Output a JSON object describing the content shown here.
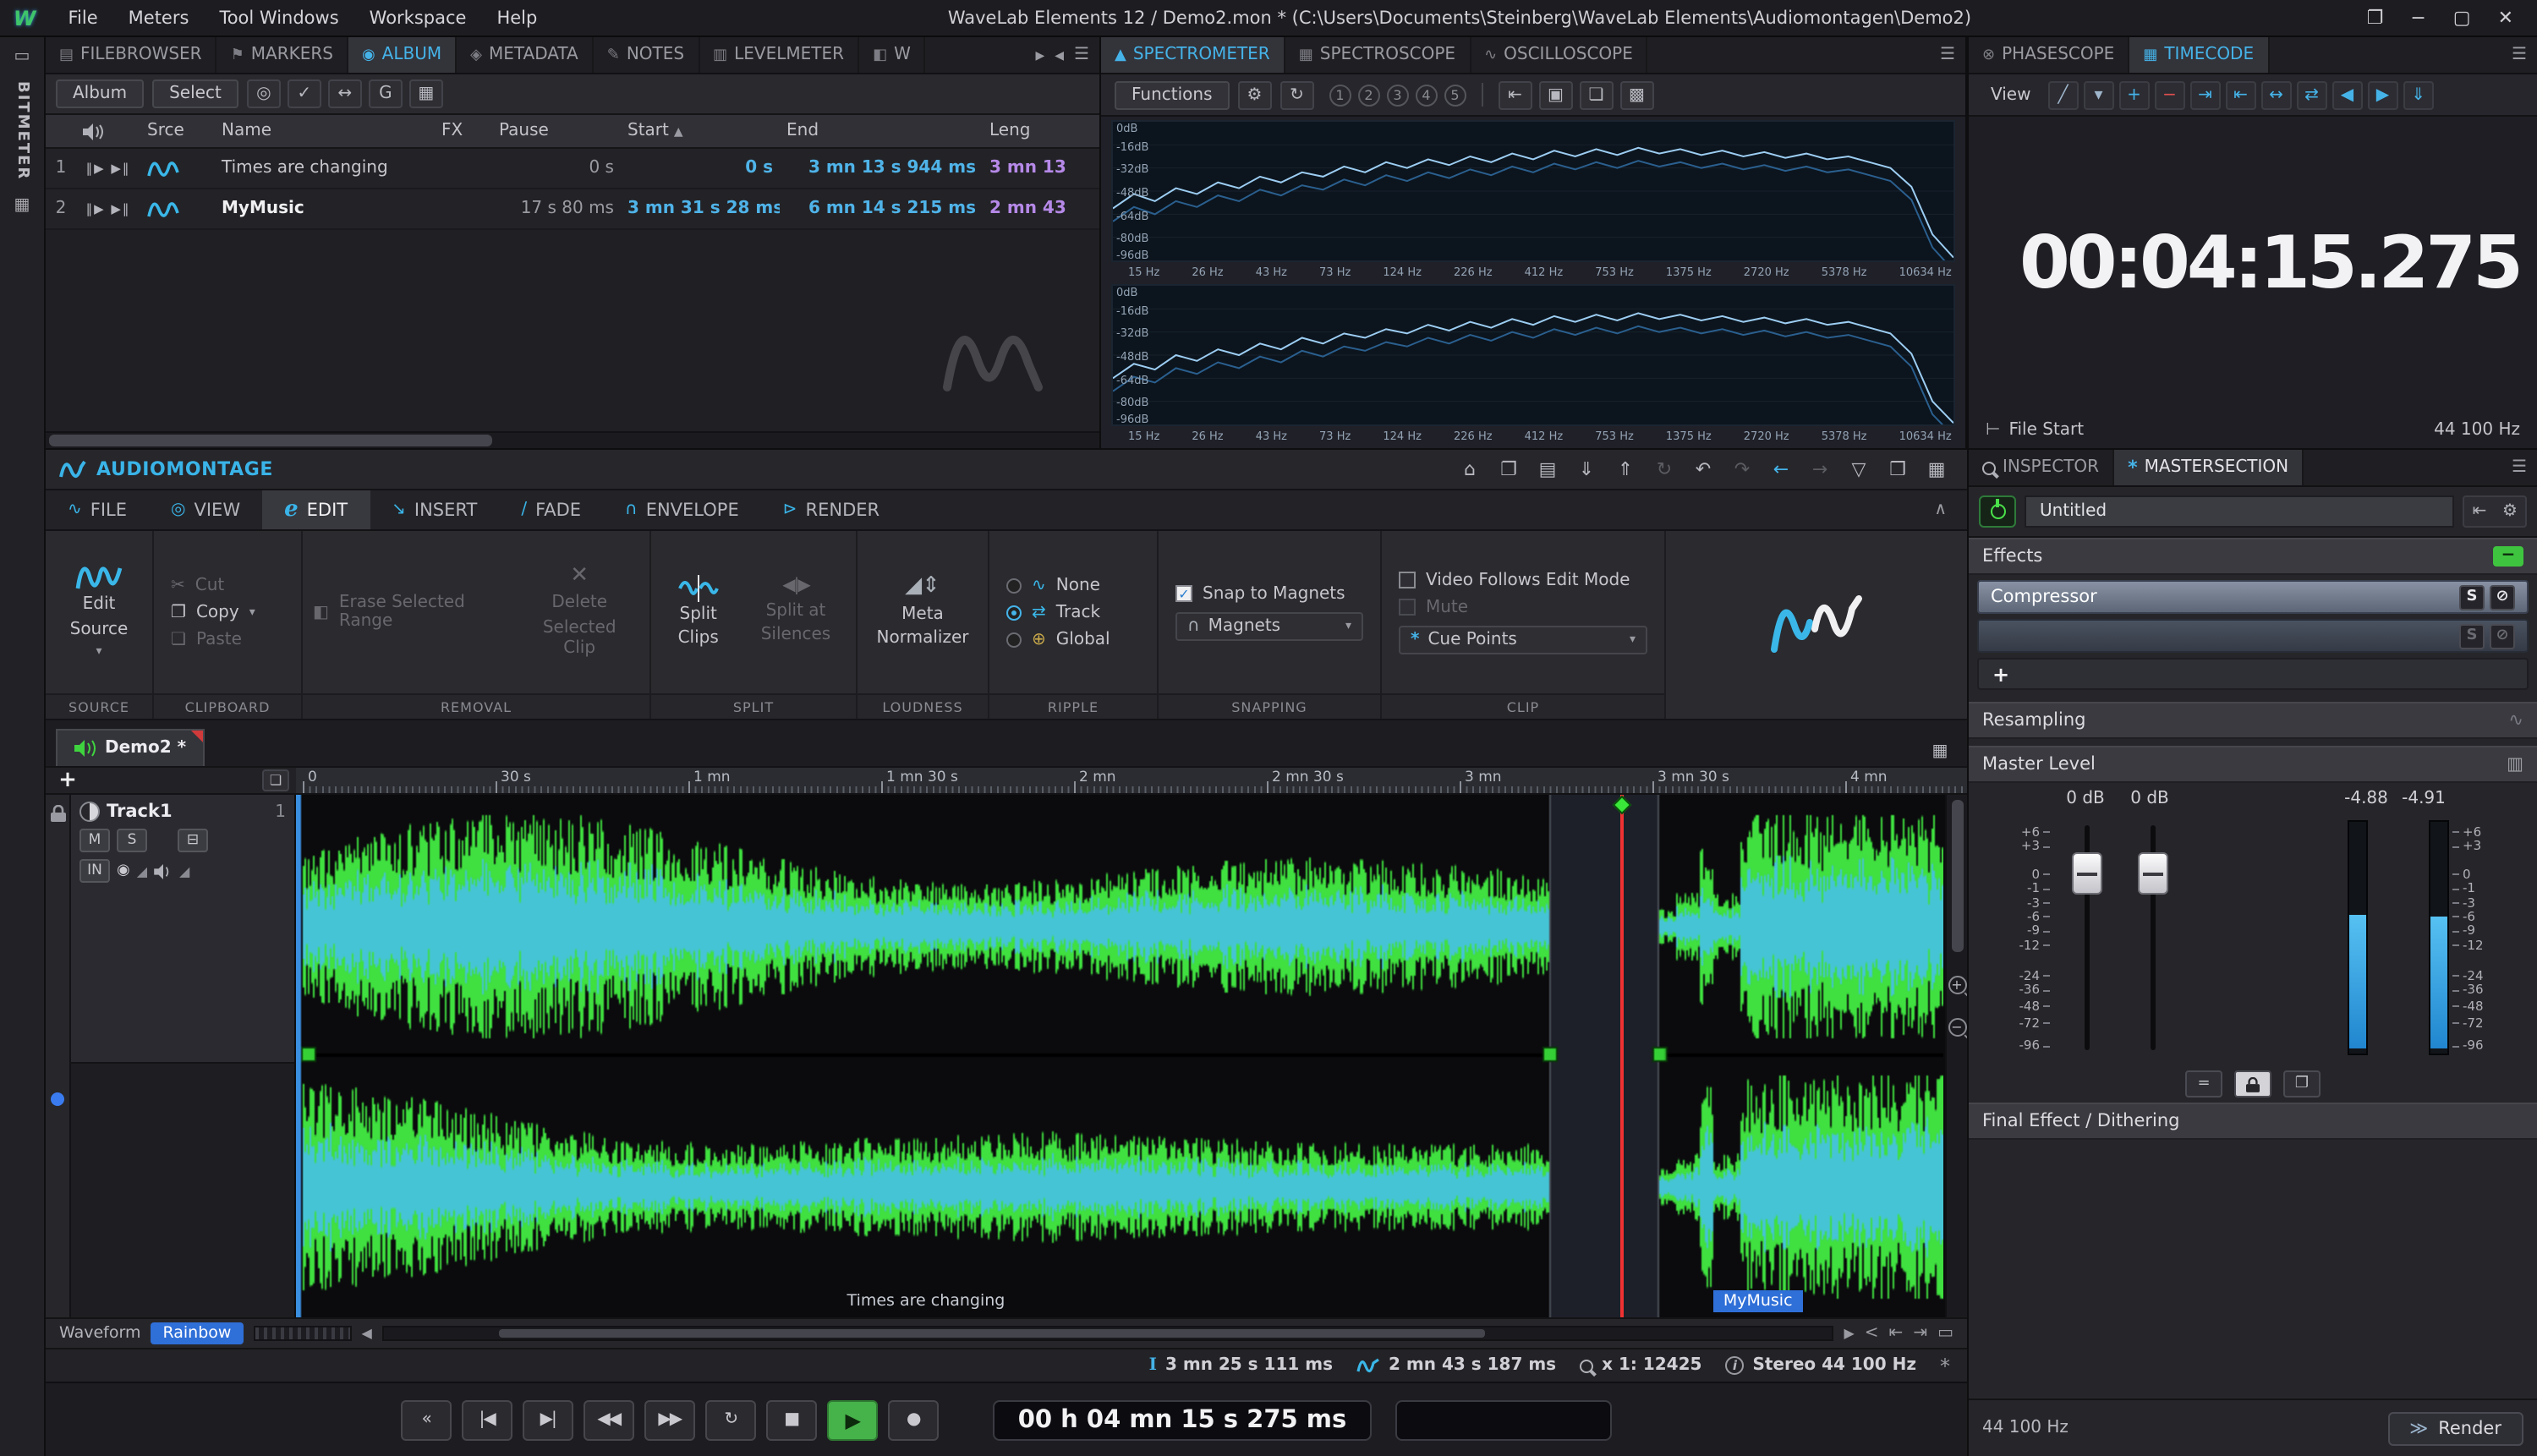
{
  "window": {
    "menu_items": [
      "File",
      "Meters",
      "Tool Windows",
      "Workspace",
      "Help"
    ],
    "title": "WaveLab Elements 12 / Demo2.mon * (C:\\Users\\Documents\\Steinberg\\WaveLab Elements\\Audiomontagen\\Demo2)",
    "logo": "W",
    "controls": [
      {
        "g": "❐",
        "n": "fullscreen-button"
      },
      {
        "g": "−",
        "n": "minimize-button"
      },
      {
        "g": "▢",
        "n": "maximize-button"
      },
      {
        "g": "✕",
        "n": "close-button"
      }
    ]
  },
  "bitmeter": {
    "label": "BITMETER"
  },
  "album": {
    "tabs": [
      {
        "icon": "▤",
        "label": "FILEBROWSER"
      },
      {
        "icon": "⚑",
        "label": "MARKERS"
      },
      {
        "icon": "◉",
        "label": "ALBUM"
      },
      {
        "icon": "◈",
        "label": "METADATA"
      },
      {
        "icon": "✎",
        "label": "NOTES"
      },
      {
        "icon": "▥",
        "label": "LEVELMETER"
      },
      {
        "icon": "◧",
        "label": "W"
      }
    ],
    "active_tab": 2,
    "buttons": [
      "Album",
      "Select"
    ],
    "tool_icons": [
      {
        "g": "◎",
        "n": "autoplay-mode-button"
      },
      {
        "g": "✓",
        "n": "apply-button"
      },
      {
        "g": "↔",
        "n": "pregap-button"
      },
      {
        "g": "G",
        "n": "regenerate-button"
      },
      {
        "g": "▦",
        "n": "grid-button"
      }
    ],
    "columns": [
      "Srce",
      "Name",
      "FX",
      "Pause",
      "Start",
      "End",
      "Leng"
    ],
    "rows": [
      {
        "num": "1",
        "name": "Times are changing",
        "pause": "0 s",
        "start": "0 s",
        "end": "3 mn 13 s 944 ms",
        "leng": "3 mn 13"
      },
      {
        "num": "2",
        "name": "MyMusic",
        "pause": "17 s 80 ms",
        "start": "3 mn 31 s 28 ms",
        "end": "6 mn 14 s 215 ms",
        "leng": "2 mn 43"
      }
    ]
  },
  "spectro": {
    "tabs": [
      {
        "icon": "▲",
        "label": "SPECTROMETER"
      },
      {
        "icon": "▦",
        "label": "SPECTROSCOPE"
      },
      {
        "icon": "∿",
        "label": "OSCILLOSCOPE"
      }
    ],
    "active_tab": 0,
    "functions": "Functions",
    "gear": "⚙",
    "refresh": "↻",
    "presets": [
      "1",
      "2",
      "3",
      "4",
      "5"
    ],
    "right_icons": [
      {
        "g": "⇤",
        "n": "export-spectrum-button"
      },
      {
        "g": "▣",
        "n": "snapshot-button"
      },
      {
        "g": "❏",
        "n": "copy-spectrum-button"
      },
      {
        "g": "▩",
        "n": "save-image-button"
      }
    ],
    "db": [
      "0dB",
      "-16dB",
      "-32dB",
      "-48dB",
      "-64dB",
      "-80dB",
      "-96dB"
    ],
    "freq": [
      "15 Hz",
      "26 Hz",
      "43 Hz",
      "73 Hz",
      "124 Hz",
      "226 Hz",
      "412 Hz",
      "753 Hz",
      "1375 Hz",
      "2720 Hz",
      "5378 Hz",
      "10634 Hz"
    ],
    "top": [
      -60,
      -50,
      -55,
      -46,
      -50,
      -42,
      -46,
      -38,
      -42,
      -35,
      -38,
      -31,
      -35,
      -28,
      -32,
      -26,
      -30,
      -24,
      -28,
      -22,
      -26,
      -20,
      -24,
      -19,
      -23,
      -18,
      -22,
      -19,
      -23,
      -20,
      -24,
      -21,
      -25,
      -22,
      -26,
      -24,
      -28,
      -32,
      -45,
      -78,
      -94
    ],
    "bottom": [
      -64,
      -54,
      -58,
      -48,
      -52,
      -44,
      -48,
      -40,
      -44,
      -36,
      -40,
      -33,
      -36,
      -30,
      -33,
      -27,
      -31,
      -25,
      -29,
      -23,
      -27,
      -21,
      -25,
      -20,
      -24,
      -19,
      -23,
      -20,
      -24,
      -21,
      -25,
      -22,
      -26,
      -23,
      -27,
      -25,
      -29,
      -33,
      -47,
      -80,
      -95
    ]
  },
  "timecode": {
    "tabs": [
      {
        "icon": "⊗",
        "label": "PHASESCOPE"
      },
      {
        "icon": "▦",
        "label": "TIMECODE"
      }
    ],
    "active_tab": 1,
    "view": "View",
    "tools": [
      {
        "g": "╱",
        "n": "line-tool-icon",
        "c": ""
      },
      {
        "g": "▾",
        "n": "drop-marker-icon",
        "c": ""
      },
      {
        "g": "+",
        "n": "add-marker-button",
        "c": "blue"
      },
      {
        "g": "−",
        "n": "delete-marker-button",
        "c": "red"
      },
      {
        "g": "⇥",
        "n": "snap-left-icon",
        "c": "blue"
      },
      {
        "g": "⇤",
        "n": "snap-right-icon",
        "c": "blue"
      },
      {
        "g": "↔",
        "n": "spread-markers-icon",
        "c": "blue"
      },
      {
        "g": "⇄",
        "n": "swap-markers-icon",
        "c": "blue"
      },
      {
        "g": "◀",
        "n": "prev-marker-icon",
        "c": "blue"
      },
      {
        "g": "▶",
        "n": "next-marker-icon",
        "c": "blue"
      },
      {
        "g": "⇓",
        "n": "import-markers-icon",
        "c": "blue"
      }
    ],
    "display": "00:04:15.275",
    "file_start": "File Start",
    "rate": "44 100 Hz"
  },
  "montage": {
    "title": "AUDIOMONTAGE",
    "header_icons": [
      {
        "g": "⌂",
        "n": "home-button",
        "c": ""
      },
      {
        "g": "❐",
        "n": "new-window-button",
        "c": ""
      },
      {
        "g": "▤",
        "n": "open-folder-button",
        "c": ""
      },
      {
        "g": "⇓",
        "n": "save-button",
        "c": ""
      },
      {
        "g": "⇑",
        "n": "export-button",
        "c": ""
      },
      {
        "g": "↻",
        "n": "sync-button",
        "c": "dim"
      },
      {
        "g": "↶",
        "n": "undo-button",
        "c": ""
      },
      {
        "g": "↷",
        "n": "redo-button",
        "c": "dim"
      },
      {
        "g": "←",
        "n": "nav-back-button",
        "c": "blue"
      },
      {
        "g": "→",
        "n": "nav-forward-button",
        "c": "dim"
      },
      {
        "g": "▽",
        "n": "filter-button",
        "c": ""
      },
      {
        "g": "❒",
        "n": "float-window-button",
        "c": ""
      },
      {
        "g": "▦",
        "n": "panel-layout-button",
        "c": ""
      }
    ],
    "tabs": [
      {
        "icon": "∿",
        "label": "FILE"
      },
      {
        "icon": "◎",
        "label": "VIEW"
      },
      {
        "icon": "e",
        "label": "EDIT"
      },
      {
        "icon": "↘",
        "label": "INSERT"
      },
      {
        "icon": "/",
        "label": "FADE"
      },
      {
        "icon": "∩",
        "label": "ENVELOPE"
      },
      {
        "icon": "⊳",
        "label": "RENDER"
      }
    ],
    "active_tab": 2,
    "src": {
      "l1": "Edit",
      "l2": "Source",
      "label": "SOURCE"
    },
    "clip_board": {
      "cut": "Cut",
      "copy": "Copy",
      "paste": "Paste",
      "label": "CLIPBOARD"
    },
    "removal": {
      "erase": "Erase Selected Range",
      "d1": "Delete",
      "d2": "Selected Clip",
      "label": "REMOVAL"
    },
    "split": {
      "c1": "Split",
      "c2": "Clips",
      "s1": "Split at",
      "s2": "Silences",
      "label": "SPLIT"
    },
    "loud": {
      "m1": "Meta",
      "m2": "Normalizer",
      "label": "LOUDNESS"
    },
    "ripple": {
      "options": [
        "None",
        "Track",
        "Global"
      ],
      "icons": [
        "∿",
        "⇄",
        "⊕"
      ],
      "selected": 1,
      "label": "RIPPLE"
    },
    "snap": {
      "cb": "Snap to Magnets",
      "dd": "Magnets",
      "label": "SNAPPING"
    },
    "clipg": {
      "cb1": "Video Follows Edit Mode",
      "cb2": "Mute",
      "dd": "Cue Points",
      "label": "CLIP"
    },
    "doc_tab": "Demo2 *",
    "track": {
      "name": "Track1",
      "num": "1",
      "m": "M",
      "s": "S",
      "input": "IN"
    },
    "ruler": [
      {
        "s": 0,
        "label": "0"
      },
      {
        "s": 30,
        "label": "30 s"
      },
      {
        "s": 60,
        "label": "1 mn"
      },
      {
        "s": 90,
        "label": "1 mn 30 s"
      },
      {
        "s": 120,
        "label": "2 mn"
      },
      {
        "s": 150,
        "label": "2 mn 30 s"
      },
      {
        "s": 180,
        "label": "3 mn"
      },
      {
        "s": 210,
        "label": "3 mn 30 s"
      },
      {
        "s": 240,
        "label": "4 mn"
      }
    ],
    "clips": [
      {
        "label": "Times are changing",
        "start_s": 0,
        "end_s": 193.944
      },
      {
        "label": "MyMusic",
        "start_s": 211.028,
        "end_s": 374.215
      }
    ],
    "cursor_s": 205.111,
    "foot": {
      "a": "Waveform",
      "b": "Rainbow"
    },
    "status": [
      {
        "icon": "ibeam",
        "text": "3 mn 25 s 111 ms"
      },
      {
        "icon": "wave",
        "text": "2 mn 43 s 187 ms"
      },
      {
        "icon": "mag",
        "text": "x 1: 12425"
      },
      {
        "icon": "info",
        "text": "Stereo 44 100 Hz"
      }
    ],
    "transport": [
      {
        "g": "«",
        "n": "prev-marker-button",
        "c": ""
      },
      {
        "g": "|◀",
        "n": "go-to-start-button",
        "c": ""
      },
      {
        "g": "▶|",
        "n": "go-to-end-button",
        "c": ""
      },
      {
        "g": "◀◀",
        "n": "rewind-button",
        "c": ""
      },
      {
        "g": "▶▶",
        "n": "fast-forward-button",
        "c": ""
      },
      {
        "g": "↻",
        "n": "loop-button",
        "c": ""
      },
      {
        "g": "■",
        "n": "stop-button",
        "c": ""
      },
      {
        "g": "▶",
        "n": "play-button",
        "c": "play"
      },
      {
        "g": "●",
        "n": "record-button",
        "c": ""
      }
    ],
    "transport_time": "00 h 04 mn 15 s 275 ms"
  },
  "master": {
    "tabs": [
      "INSPECTOR",
      "MASTERSECTION"
    ],
    "active_tab": 1,
    "preset": "Untitled",
    "effects": "Effects",
    "slot1": "Compressor",
    "slot_solo": "S",
    "add": "+",
    "resampling": "Resampling",
    "master_level": "Master Level",
    "values": [
      "0 dB",
      "0 dB",
      "-4.88",
      "-4.91"
    ],
    "scale": [
      "+6",
      "+3",
      "0",
      "-1",
      "-3",
      "-6",
      "-9",
      "-12",
      "-24",
      "-36",
      "-48",
      "-72",
      "-96"
    ],
    "final": "Final Effect / Dithering",
    "rate": "44 100 Hz",
    "render": "Render"
  }
}
